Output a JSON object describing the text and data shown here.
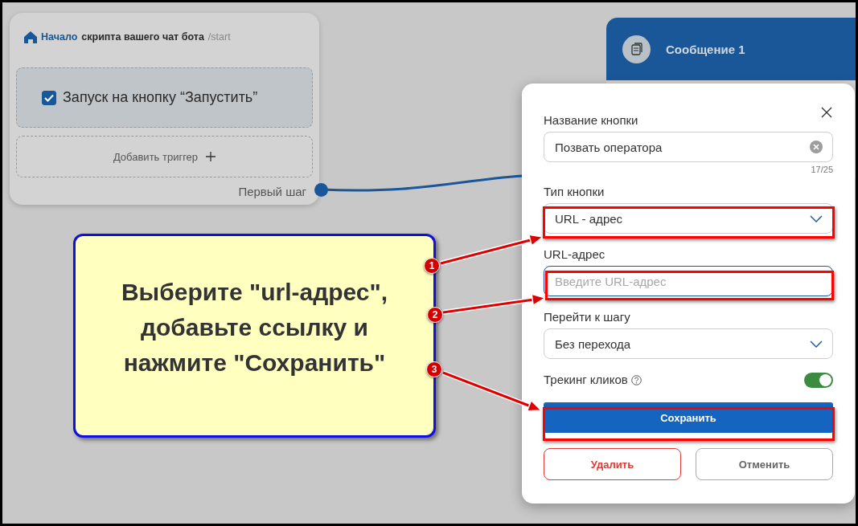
{
  "start_node": {
    "home_word": "Начало",
    "title": "скрипта вашего чат бота",
    "command": "/start",
    "trigger": {
      "label": "Запуск на кнопку “Запустить”",
      "checked": true
    },
    "add_trigger": "Добавить триггер",
    "output_label": "Первый шаг"
  },
  "message_node": {
    "title": "Сообщение 1"
  },
  "dialog": {
    "fields": [
      {
        "kind": "text",
        "label": "Название кнопки",
        "value": "Позвать оператора",
        "counter": "17/25"
      },
      {
        "kind": "select",
        "label": "Тип кнопки",
        "value": "URL - адрес"
      },
      {
        "kind": "input",
        "label": "URL-адрес",
        "placeholder": "Введите URL-адрес",
        "focused": true
      },
      {
        "kind": "select",
        "label": "Перейти к шагу",
        "value": "Без перехода"
      }
    ],
    "toggle": {
      "label": "Трекинг кликов",
      "on": true
    },
    "buttons": [
      {
        "kind": "primary",
        "label": "Сохранить"
      },
      {
        "kind": "danger",
        "label": "Удалить"
      },
      {
        "kind": "secondary",
        "label": "Отменить"
      }
    ]
  },
  "callout": {
    "text": "Выберите \"url-адрес\", добавьте ссылку и нажмите \"Сохранить\"",
    "markers": [
      "1",
      "2",
      "3"
    ]
  }
}
